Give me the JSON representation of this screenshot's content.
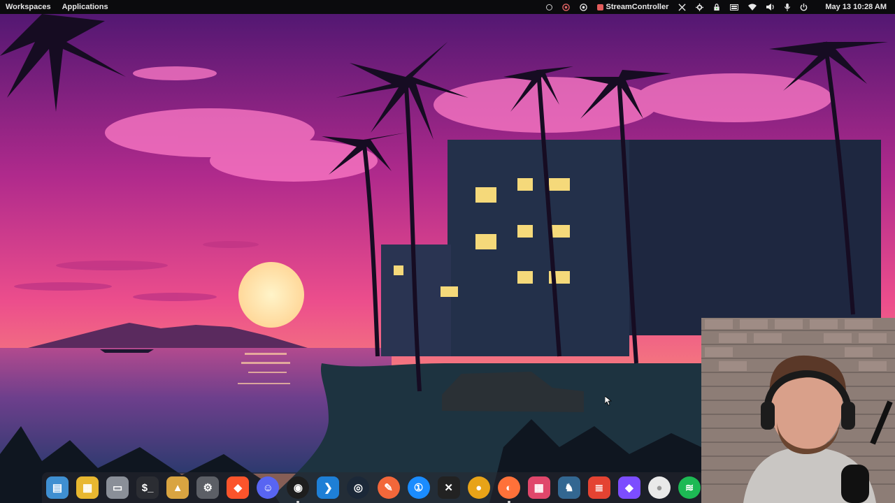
{
  "topbar": {
    "workspaces_label": "Workspaces",
    "applications_label": "Applications",
    "stream_controller_label": "StreamController",
    "clock": "May 13  10:28 AM",
    "tray_icons": [
      "circle-status-icon",
      "obs-tray-icon",
      "record-icon",
      "stream-controller-icon",
      "x-tray-icon",
      "settings-tray-icon",
      "lock-tray-icon",
      "keyboard-tray-icon",
      "wifi-icon",
      "volume-icon",
      "microphone-icon",
      "power-icon"
    ]
  },
  "dock": {
    "apps": [
      {
        "name": "files-manager",
        "icon": "folder-window-icon",
        "color": "#3f8fd1",
        "running": false
      },
      {
        "name": "app-grid",
        "icon": "grid-icon",
        "color": "#e8b730",
        "running": false
      },
      {
        "name": "folder",
        "icon": "folder-icon",
        "color": "#8a8f98",
        "running": false
      },
      {
        "name": "terminal",
        "icon": "terminal-icon",
        "color": "#2b2d33",
        "running": false
      },
      {
        "name": "installer",
        "icon": "package-icon",
        "color": "#d9a441",
        "running": false
      },
      {
        "name": "settings",
        "icon": "gear-icon",
        "color": "#5c5f66",
        "running": false
      },
      {
        "name": "brave",
        "icon": "brave-icon",
        "color": "#fb542b",
        "running": false
      },
      {
        "name": "discord",
        "icon": "discord-icon",
        "color": "#5865f2",
        "running": false
      },
      {
        "name": "obs",
        "icon": "obs-icon",
        "color": "#1e1e1e",
        "running": true
      },
      {
        "name": "vscode",
        "icon": "vscode-icon",
        "color": "#1e7fd6",
        "running": false
      },
      {
        "name": "steam",
        "icon": "steam-icon",
        "color": "#1b2838",
        "running": false
      },
      {
        "name": "pen-tool",
        "icon": "pen-icon",
        "color": "#f2673a",
        "running": false
      },
      {
        "name": "1password",
        "icon": "key-icon",
        "color": "#1a8cff",
        "running": false
      },
      {
        "name": "x-app",
        "icon": "x-icon",
        "color": "#222222",
        "running": false
      },
      {
        "name": "audio-app",
        "icon": "disc-icon",
        "color": "#e8a317",
        "running": false
      },
      {
        "name": "firefox",
        "icon": "firefox-icon",
        "color": "#ff7139",
        "running": true
      },
      {
        "name": "calculator",
        "icon": "calculator-icon",
        "color": "#e0476b",
        "running": false
      },
      {
        "name": "postgres",
        "icon": "elephant-icon",
        "color": "#336791",
        "running": false
      },
      {
        "name": "todoist",
        "icon": "todo-icon",
        "color": "#e44332",
        "running": false
      },
      {
        "name": "obsidian",
        "icon": "gem-icon",
        "color": "#7c4dff",
        "running": false
      },
      {
        "name": "egg-app",
        "icon": "egg-icon",
        "color": "#e9e9e9",
        "running": false
      },
      {
        "name": "spotify",
        "icon": "spotify-icon",
        "color": "#1db954",
        "running": false
      }
    ]
  },
  "colors": {
    "sky_top": "#5a1a78",
    "sky_mid": "#d63a8f",
    "sky_low": "#f58a6b",
    "sun": "#ffe9b5",
    "sea": "#3a3470",
    "ground": "#1d2c3a"
  }
}
